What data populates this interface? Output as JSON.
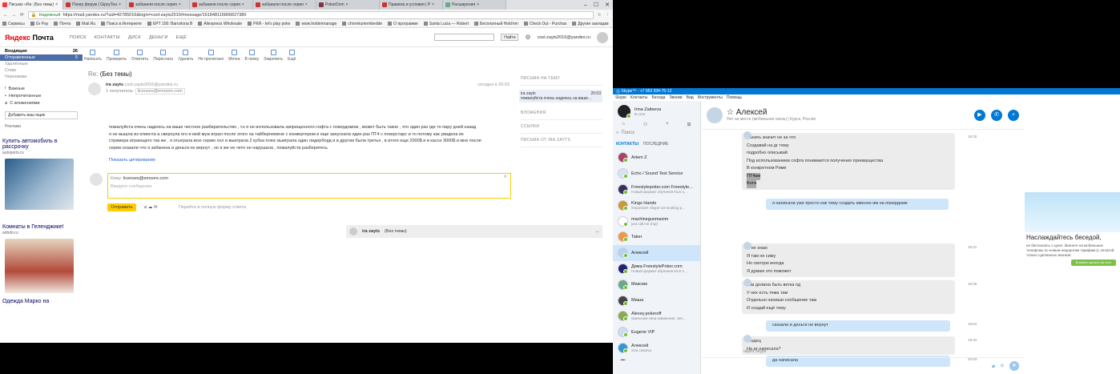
{
  "tabs": [
    {
      "label": "Письмо «Re: (Без темы)",
      "fav": "y"
    },
    {
      "label": "Покер форум | GipsyTea",
      "fav": "r"
    },
    {
      "label": "забанили после серия",
      "fav": "r"
    },
    {
      "label": "забанили после серия",
      "fav": "r"
    },
    {
      "label": "забанили после серия",
      "fav": "r"
    },
    {
      "label": "PokerDom",
      "fav": "p"
    },
    {
      "label": "Правила и условия | P",
      "fav": "r"
    },
    {
      "label": "Расширения",
      "fav": "g"
    }
  ],
  "address": {
    "secure": "Надежный",
    "url": "https://mail.yandex.ru/?uid=42785016&login=cool-zayts2016#message/161848115806627380"
  },
  "bookmarks": [
    "Сервисы",
    "Gr Pay",
    "Почта",
    "Mail.Ru",
    "Поиск в Интернете",
    "EPT 100: Barcelona B",
    "Aliexpress Wholesale",
    "PKR - let's play poke",
    "www.holdermanage",
    "chromiumembedde",
    "О программе",
    "Santa Lucia — Robert",
    "Бесплатный Hold'em",
    "Check Out - Purchas",
    "Другие закладки"
  ],
  "mail": {
    "logo_a": "Яндекс",
    "logo_b": "Почта",
    "nav": [
      "ПОИСК",
      "КОНТАКТЫ",
      "ДИСК",
      "ДЕНЬГИ",
      "ЕЩЁ"
    ],
    "find_btn": "Найти",
    "user": "cool.zayts2016@yandex.ru",
    "folders": [
      {
        "label": "Входящие",
        "count": "26",
        "style": "bold"
      },
      {
        "label": "Отправленные",
        "count": "5",
        "style": "sel"
      },
      {
        "label": "Удалённые",
        "count": "",
        "style": ""
      },
      {
        "label": "Спам",
        "count": "",
        "style": ""
      },
      {
        "label": "Черновики",
        "count": "",
        "style": ""
      }
    ],
    "tags": [
      "Важные",
      "Непрочитанные",
      "С вложениями"
    ],
    "add_box": "Добавить ваш ящик",
    "ads_label": "Реклама",
    "ad1_title": "Купить автомобиль в рассрочку",
    "ad1_url": "autoports.ru",
    "ad2_title": "Комнаты в Геленджике!",
    "ad2_url": "airbnb.ru",
    "ad3_title": "Одежда Марко на",
    "toolbar": [
      "Написать",
      "Проверить",
      "Ответить",
      "Переслать",
      "Удалить",
      "Не прочитано",
      "Метка",
      "В папку",
      "Закрепить",
      "Ещё"
    ],
    "subject_prefix": "Re:",
    "subject": "(Без темы)",
    "sender": "ira zayts",
    "sender_email": "cool.zayts2016@yandex.ru",
    "recipients": "1 получатель:",
    "recipient_email": "licenses@emoore.com",
    "date": "сегодня в 20:03",
    "body": [
      "пожалуйста очень надеюсь на ваше честное разбирательство , т.к я не использовала запрещенного софта с покердомом , может быть такое , что один раз где то пару дней назад",
      "я не вышла из клиента а свернула его и мой муж играл после этого на тайбернемене с конвертером и еще запускала один раз ПТ4 с покерстарс и то потому как увидела их",
      "стримера играющего так же . я отыграла всю серию ххл и выиграла 2 кубка плюс выиграла один лидерборд и в другом была третья , в итоге еще 2000$ и в кассе 3000$ и мне после",
      "серии сказали что я забанена и деньги не вернут , но я же не чето не нарушала , пожалуйста разберитесь"
    ],
    "show_quote": "Показать цитирование",
    "reply_to_label": "Кому:",
    "reply_to": "licenses@emoore.com",
    "reply_placeholder": "Введите сообщение",
    "send": "Отправить",
    "full_form": "Перейти в полную форму ответа",
    "thread_sender": "ira zayts",
    "thread_subject": "(Без темы)",
    "right_pane": {
      "h1": "ПИСЬМА НА ТЕМУ",
      "item_name": "ira zayts",
      "item_time": "20:03",
      "item_text": "пожалуйста очень надеюсь на ваше...",
      "h2": "ВЛОЖЕНИЯ",
      "h3": "ССЫЛКИ",
      "h4": "ПИСЬМА ОТ IRA ZAYTS"
    }
  },
  "skype": {
    "title": "Skype™ - +7 953 934-75-12",
    "menu": [
      "Skype",
      "Контакты",
      "Беседа",
      "Звонки",
      "Вид",
      "Инструменты",
      "Помощь"
    ],
    "me_name": "Irina Zaitseva",
    "me_status": "В сети",
    "search": "Поиск",
    "tab_contacts": "КОНТАКТЫ",
    "tab_recent": "ПОСЛЕДНИЕ",
    "contacts": [
      {
        "name": "Artem Z",
        "sub": ""
      },
      {
        "name": "Echo / Sound Test Service",
        "sub": ""
      },
      {
        "name": "Freestylepoker.com Freestyle...",
        "sub": "Новый формат обучения NLS-1..."
      },
      {
        "name": "Kings Hands",
        "sub": "!Important! Skype not working p..."
      },
      {
        "name": "machinegunmaxim",
        "sub": "just call me (mp)"
      },
      {
        "name": "Taker",
        "sub": ""
      },
      {
        "name": "Алексей",
        "sub": ""
      },
      {
        "name": "Дима FreestylePoker.com",
        "sub": "Новый формат обучения NLS-1..."
      },
      {
        "name": "Максим",
        "sub": ""
      },
      {
        "name": "Миша",
        "sub": ""
      },
      {
        "name": "Alexey.pokeroff",
        "sub": "приносим свои извинения, свя..."
      },
      {
        "name": "Eugene VIP",
        "sub": ""
      },
      {
        "name": "Алексей",
        "sub": "irina zaiseva"
      },
      {
        "name": "Алексей Покерофф",
        "sub": ""
      }
    ],
    "chat_name": "Алексей",
    "chat_status": "Нет на месте (мобильная связь)  |  Курск, Россия",
    "today": "Сегодня",
    "msgs": [
      {
        "dir": "in",
        "time": "18:30",
        "lines": [
          "Банить значит не за что",
          "Создавай на дг тему",
          "подробно описывай",
          "Под использованием софта понимается получения преимущества",
          "В конкретном Риме",
          "ПТ4ам",
          "Боти"
        ]
      },
      {
        "dir": "out",
        "time": "",
        "lines": [
          "я написала уже просто как тему создать именно им на покердоме"
        ]
      },
      {
        "dir": "in",
        "time": "18:31",
        "lines": [
          "Я не знаю",
          "Я там не сижу",
          "Но смотрю иногда",
          "Я думаю это поможет"
        ]
      },
      {
        "dir": "in",
        "time": "18:39",
        "lines": [
          "там должна быть ветка пд",
          "У них есть тема там",
          "Отдельно напиши сообщение там",
          "И создай ещё тему"
        ]
      },
      {
        "dir": "out",
        "time": "19:04",
        "lines": [
          "сказали и деньги не вернут"
        ]
      },
      {
        "dir": "in",
        "time": "19:34",
        "lines": [
          "пиздец",
          "На дг написала?"
        ]
      },
      {
        "dir": "out",
        "time": "20:03",
        "lines": [
          "да написала"
        ]
      }
    ],
    "via": "через Skype",
    "ad_title": "Наслаждайтесь беседой,",
    "ad_text": "не беспокоясь о цене. Звоните на мобильные телефоны по новым недорогим тарифам (с оплатой только сделанных звонков",
    "ad_btn": "Вложите деньги на счет"
  }
}
